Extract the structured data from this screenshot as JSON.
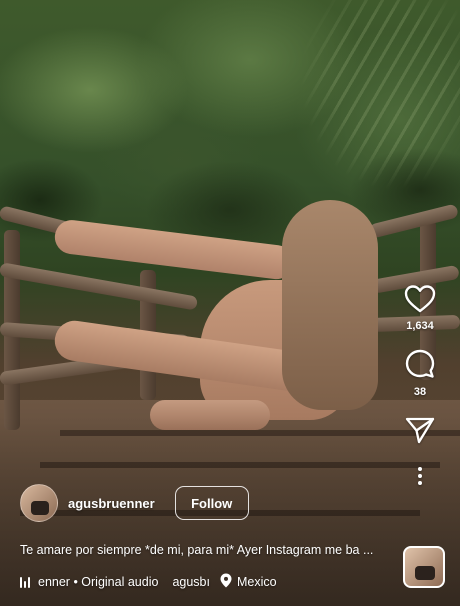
{
  "post": {
    "username": "agusbruenner",
    "follow_label": "Follow",
    "caption": "Te amare por siempre *de mi, para mi* Ayer Instagram me ba ...",
    "audio_text": "enner • Original audio",
    "second_account": "agusbı",
    "location": "Mexico"
  },
  "actions": {
    "likes": "1,634",
    "comments": "38"
  },
  "icons": {
    "like": "heart-icon",
    "comment": "comment-bubble-icon",
    "share": "paper-plane-icon",
    "more": "more-vertical-icon",
    "audio": "audio-bars-icon",
    "location": "location-pin-icon"
  },
  "colors": {
    "overlay_text": "#ffffff"
  }
}
